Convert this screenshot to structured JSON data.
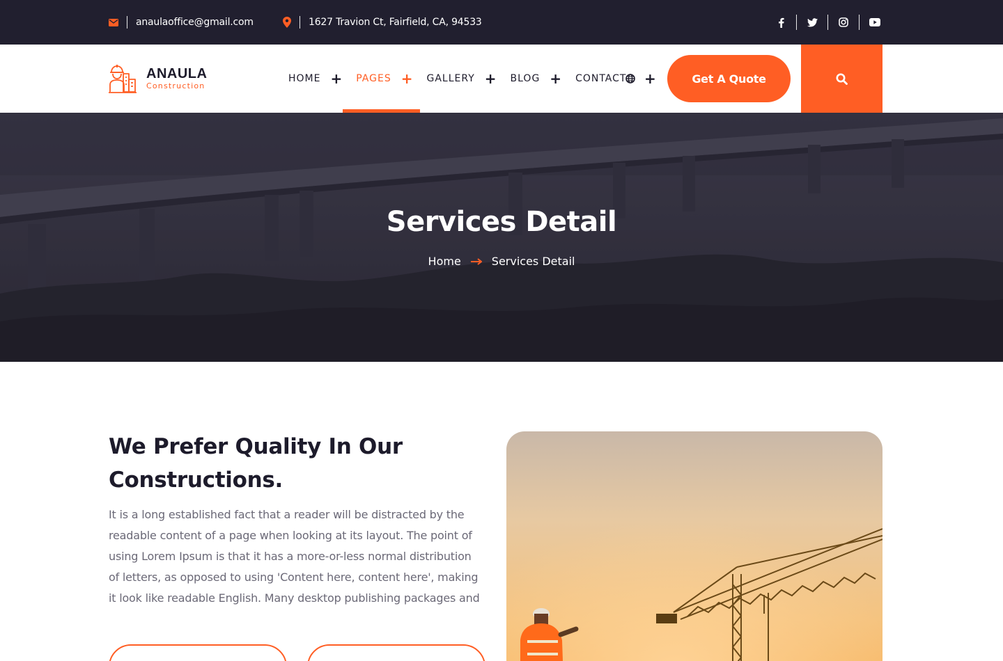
{
  "topbar": {
    "email": "anaulaoffice@gmail.com",
    "address": "1627 Travion Ct, Fairfield, CA, 94533",
    "email_icon": "envelope-icon",
    "address_icon": "map-marker-icon",
    "social": [
      {
        "icon": "facebook-icon",
        "glyph": "f"
      },
      {
        "icon": "twitter-icon",
        "glyph": ""
      },
      {
        "icon": "instagram-icon",
        "glyph": ""
      },
      {
        "icon": "youtube-icon",
        "glyph": ""
      }
    ]
  },
  "header": {
    "logo_title": "ANAULA",
    "logo_subtitle": "Construction",
    "nav": [
      {
        "label": "HOME",
        "has_submenu": true,
        "active": false
      },
      {
        "label": "PAGES",
        "has_submenu": true,
        "active": true
      },
      {
        "label": "GALLERY",
        "has_submenu": true,
        "active": false
      },
      {
        "label": "BLOG",
        "has_submenu": true,
        "active": false
      },
      {
        "label": "CONTACT",
        "has_submenu": false,
        "active": false
      }
    ],
    "language_icon": "globe-icon",
    "quote_button": "Get A Quote",
    "search_icon": "search-icon"
  },
  "hero": {
    "title": "Services Detail",
    "breadcrumb_home": "Home",
    "breadcrumb_current": "Services Detail"
  },
  "content": {
    "heading": "We Prefer Quality In Our Constructions.",
    "paragraph": "It is a long established fact that a reader will be distracted by the readable content of a page when looking at its layout. The point of using Lorem Ipsum is that it has a more-or-less normal distribution of letters, as opposed to using 'Content here, content here', making it look like readable English. Many desktop publishing packages and"
  },
  "colors": {
    "accent": "#ff5e24",
    "dark": "#211f2f",
    "text_muted": "#6b6977"
  }
}
